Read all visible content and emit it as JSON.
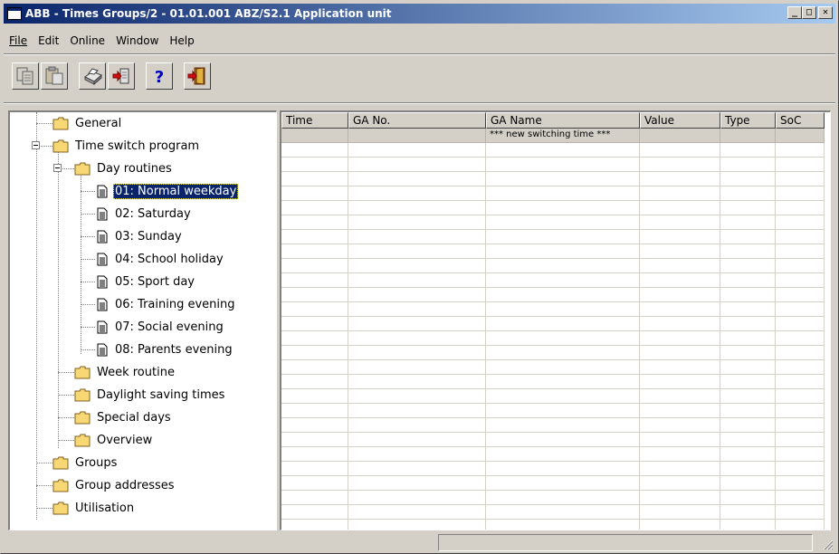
{
  "window": {
    "title": "ABB - Times Groups/2 - 01.01.001 ABZ/S2.1 Application unit",
    "buttons": {
      "minimize": "_",
      "maximize": "□",
      "close": "✕"
    }
  },
  "menu": [
    {
      "label": "File"
    },
    {
      "label": "Edit"
    },
    {
      "label": "Online"
    },
    {
      "label": "Window"
    },
    {
      "label": "Help"
    }
  ],
  "toolbar": {
    "icons": [
      "copy-icon",
      "paste-icon",
      "print-icon",
      "export-icon",
      "help-icon",
      "exit-icon"
    ]
  },
  "tree": {
    "items": [
      {
        "label": "General",
        "icon": "folder"
      },
      {
        "label": "Time switch program",
        "icon": "folder"
      },
      {
        "label": "Day routines",
        "icon": "folder"
      },
      {
        "label": "01: Normal weekday",
        "icon": "doc",
        "selected": true
      },
      {
        "label": "02: Saturday",
        "icon": "doc"
      },
      {
        "label": "03: Sunday",
        "icon": "doc"
      },
      {
        "label": "04: School holiday",
        "icon": "doc"
      },
      {
        "label": "05: Sport day",
        "icon": "doc"
      },
      {
        "label": "06: Training evening",
        "icon": "doc"
      },
      {
        "label": "07: Social evening",
        "icon": "doc"
      },
      {
        "label": "08: Parents evening",
        "icon": "doc"
      },
      {
        "label": "Week routine",
        "icon": "folder"
      },
      {
        "label": "Daylight saving times",
        "icon": "folder"
      },
      {
        "label": "Special days",
        "icon": "folder"
      },
      {
        "label": "Overview",
        "icon": "folder"
      },
      {
        "label": "Groups",
        "icon": "folder"
      },
      {
        "label": "Group addresses",
        "icon": "folder"
      },
      {
        "label": "Utilisation",
        "icon": "folder"
      }
    ]
  },
  "grid": {
    "columns": [
      "Time",
      "GA No.",
      "GA Name",
      "Value",
      "Type",
      "SoC"
    ],
    "new_entry": "*** new switching time ***"
  },
  "colors": {
    "title_start": "#0a246a",
    "title_end": "#a6caf0",
    "face": "#d4d0c8",
    "selection": "#0a246a",
    "folder": "#f8d775"
  }
}
